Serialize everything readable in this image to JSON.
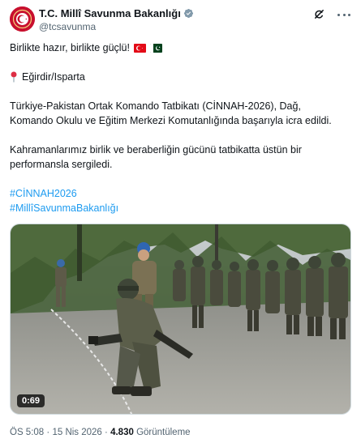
{
  "account": {
    "display_name": "T.C. Millî Savunma Bakanlığı",
    "handle": "@tcsavunma",
    "verified_color": "#829aab",
    "avatar_color": "#c8102e"
  },
  "icons": {
    "grok": "grok-icon",
    "more": "more-icon",
    "verified": "verified-badge-icon",
    "location": "round-pushpin-icon"
  },
  "tweet": {
    "line1": "Birlikte hazır, birlikte güçlü!",
    "location": "Eğirdir/Isparta",
    "para1_line1": "Türkiye-Pakistan Ortak Komando Tatbikatı (CİNNAH-2026), Dağ,",
    "para1_line2": "Komando Okulu ve Eğitim Merkezi Komutanlığında başarıyla icra edildi.",
    "para2_line1": "Kahramanlarımız birlik ve beraberliğin gücünü tatbikatta üstün bir",
    "para2_line2": "performansla sergiledi.",
    "hashtag1": "#CİNNAH2026",
    "hashtag2": "#MillîSavunmaBakanlığı",
    "link_color": "#1d9bf0"
  },
  "media": {
    "type": "video",
    "duration": "0:69"
  },
  "meta": {
    "time": "ÖS 5:08",
    "separator": "·",
    "date": "15 Nis 2026",
    "views_count": "4.830",
    "views_label": "Görüntüleme"
  }
}
